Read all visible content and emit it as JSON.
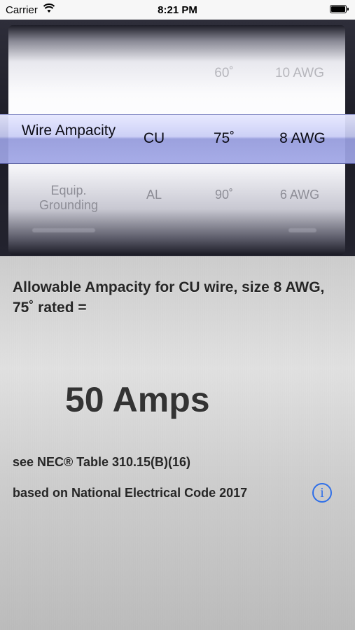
{
  "status_bar": {
    "carrier": "Carrier",
    "time": "8:21 PM"
  },
  "picker": {
    "row_top": {
      "col1": "",
      "col2": "",
      "col3": "60˚",
      "col4": "10 AWG"
    },
    "selected": {
      "col1": "Wire Ampacity",
      "col2": "CU",
      "col3": "75˚",
      "col4": "8 AWG"
    },
    "row_bottom": {
      "col1": "Equip. Grounding",
      "col2": "AL",
      "col3": "90˚",
      "col4": "6 AWG"
    }
  },
  "result": {
    "description": "Allowable Ampacity for CU wire, size 8 AWG, 75˚ rated =",
    "value": "50 Amps",
    "reference": "see NEC® Table 310.15(B)(16)",
    "code_basis": "based on National Electrical Code 2017",
    "info_symbol": "i"
  },
  "colors": {
    "accent": "#2f6fe8",
    "selection": "#a4aae6"
  },
  "icons": [
    "wifi-icon",
    "battery-icon",
    "info-icon"
  ]
}
